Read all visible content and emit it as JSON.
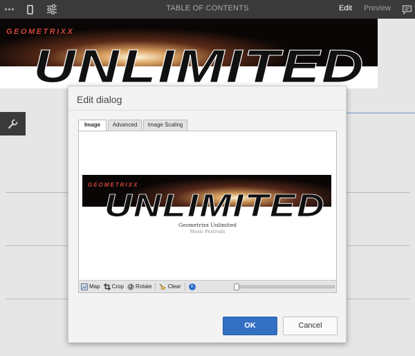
{
  "toolbar": {
    "title": "TABLE OF CONTENTS",
    "edit_label": "Edit",
    "preview_label": "Preview"
  },
  "banner": {
    "brand": "GEOMETRIXX",
    "headline": "UNLIMITED"
  },
  "dialog": {
    "title": "Edit dialog",
    "tabs": [
      {
        "label": "Image"
      },
      {
        "label": "Advanced"
      },
      {
        "label": "Image Scaling"
      }
    ],
    "image": {
      "brand": "GEOMETRIXX",
      "headline": "UNLIMITED",
      "caption_title": "Geometrixx Unlimited",
      "caption_subtitle": "Music Festivals"
    },
    "image_toolbar": {
      "map": "Map",
      "crop": "Crop",
      "rotate": "Rotate",
      "clear": "Clear"
    },
    "zoom": 0,
    "ok_label": "OK",
    "cancel_label": "Cancel"
  },
  "colors": {
    "toolbar": "#3a3a3a",
    "accent": "#3370c4",
    "brand_red": "#d0463a"
  }
}
